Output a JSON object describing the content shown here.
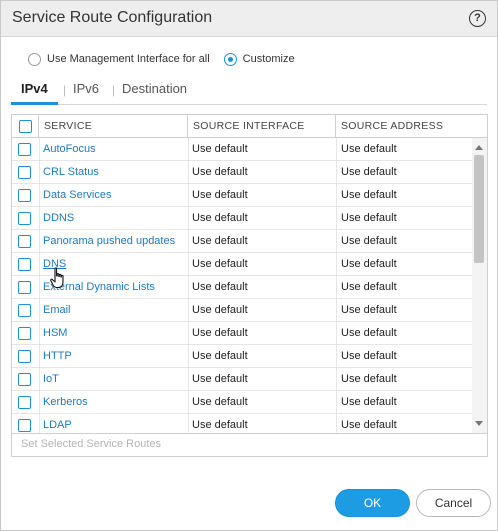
{
  "dialog": {
    "title": "Service Route Configuration",
    "help_label": "?"
  },
  "mode": {
    "option_all": "Use Management Interface for all",
    "option_custom": "Customize",
    "selected": "Customize"
  },
  "tabs": [
    {
      "label": "IPv4",
      "active": true
    },
    {
      "label": "IPv6",
      "active": false
    },
    {
      "label": "Destination",
      "active": false
    }
  ],
  "table": {
    "columns": [
      "SERVICE",
      "SOURCE INTERFACE",
      "SOURCE ADDRESS"
    ],
    "rows": [
      {
        "service": "AutoFocus",
        "source_interface": "Use default",
        "source_address": "Use default"
      },
      {
        "service": "CRL Status",
        "source_interface": "Use default",
        "source_address": "Use default"
      },
      {
        "service": "Data Services",
        "source_interface": "Use default",
        "source_address": "Use default"
      },
      {
        "service": "DDNS",
        "source_interface": "Use default",
        "source_address": "Use default"
      },
      {
        "service": "Panorama pushed updates",
        "source_interface": "Use default",
        "source_address": "Use default"
      },
      {
        "service": "DNS",
        "source_interface": "Use default",
        "source_address": "Use default"
      },
      {
        "service": "External Dynamic Lists",
        "source_interface": "Use default",
        "source_address": "Use default"
      },
      {
        "service": "Email",
        "source_interface": "Use default",
        "source_address": "Use default"
      },
      {
        "service": "HSM",
        "source_interface": "Use default",
        "source_address": "Use default"
      },
      {
        "service": "HTTP",
        "source_interface": "Use default",
        "source_address": "Use default"
      },
      {
        "service": "IoT",
        "source_interface": "Use default",
        "source_address": "Use default"
      },
      {
        "service": "Kerberos",
        "source_interface": "Use default",
        "source_address": "Use default"
      },
      {
        "service": "LDAP",
        "source_interface": "Use default",
        "source_address": "Use default"
      }
    ],
    "footer_action": "Set Selected Service Routes"
  },
  "buttons": {
    "ok": "OK",
    "cancel": "Cancel"
  },
  "colors": {
    "accent": "#1e9ce3",
    "link": "#1e79c1",
    "titlebar": "#eeeeee"
  },
  "icons": {
    "help": "help-circle-icon",
    "cursor": "hand-pointer-icon"
  }
}
